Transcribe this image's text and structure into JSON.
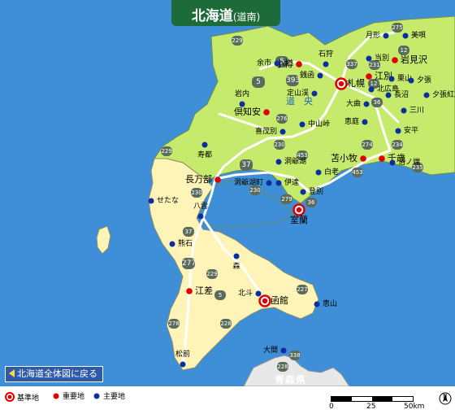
{
  "header": {
    "title": "北海道",
    "subtitle": "(道南)"
  },
  "area_label": "道　央",
  "prefecture_label": "青森県",
  "back_link": "北海道全体図に戻る",
  "legend": [
    {
      "label": "基準地",
      "color": "#e00000"
    },
    {
      "label": "重要地",
      "color": "#e00000"
    },
    {
      "label": "主要地",
      "color": "#0a2fa0"
    }
  ],
  "scale": {
    "ticks": [
      "0",
      "25",
      "50km"
    ]
  },
  "north": "N",
  "places": [
    {
      "name": "札幌",
      "kind": "基準地"
    },
    {
      "name": "室蘭",
      "kind": "基準地"
    },
    {
      "name": "函館",
      "kind": "基準地"
    },
    {
      "name": "小樽",
      "kind": "重要地"
    },
    {
      "name": "江別",
      "kind": "重要地"
    },
    {
      "name": "岩見沢",
      "kind": "重要地"
    },
    {
      "name": "千歳",
      "kind": "重要地"
    },
    {
      "name": "苫小牧",
      "kind": "重要地"
    },
    {
      "name": "倶知安",
      "kind": "重要地"
    },
    {
      "name": "長万部",
      "kind": "重要地"
    },
    {
      "name": "江差",
      "kind": "重要地"
    },
    {
      "name": "月形",
      "kind": "主要地"
    },
    {
      "name": "美唄",
      "kind": "主要地"
    },
    {
      "name": "石狩",
      "kind": "主要地"
    },
    {
      "name": "当別",
      "kind": "主要地"
    },
    {
      "name": "余市",
      "kind": "主要地"
    },
    {
      "name": "銭函",
      "kind": "主要地"
    },
    {
      "name": "栗山",
      "kind": "主要地"
    },
    {
      "name": "夕張",
      "kind": "主要地"
    },
    {
      "name": "北広島",
      "kind": "主要地"
    },
    {
      "name": "長沼",
      "kind": "主要地"
    },
    {
      "name": "夕張紅葉山",
      "kind": "主要地"
    },
    {
      "name": "大曲",
      "kind": "主要地"
    },
    {
      "name": "三川",
      "kind": "主要地"
    },
    {
      "name": "岩内",
      "kind": "主要地"
    },
    {
      "name": "定山渓",
      "kind": "主要地"
    },
    {
      "name": "中山峠",
      "kind": "主要地"
    },
    {
      "name": "喜茂別",
      "kind": "主要地"
    },
    {
      "name": "恵庭",
      "kind": "主要地"
    },
    {
      "name": "安平",
      "kind": "主要地"
    },
    {
      "name": "寿都",
      "kind": "主要地"
    },
    {
      "name": "沼ノ端",
      "kind": "主要地"
    },
    {
      "name": "洞爺湖",
      "kind": "主要地"
    },
    {
      "name": "洞爺湖町",
      "kind": "主要地"
    },
    {
      "name": "伊達",
      "kind": "主要地"
    },
    {
      "name": "白老",
      "kind": "主要地"
    },
    {
      "name": "登別",
      "kind": "主要地"
    },
    {
      "name": "せたな",
      "kind": "主要地"
    },
    {
      "name": "八雲",
      "kind": "主要地"
    },
    {
      "name": "熊石",
      "kind": "主要地"
    },
    {
      "name": "森",
      "kind": "主要地"
    },
    {
      "name": "北斗",
      "kind": "主要地"
    },
    {
      "name": "恵山",
      "kind": "主要地"
    },
    {
      "name": "松前",
      "kind": "主要地"
    },
    {
      "name": "大間",
      "kind": "主要地"
    }
  ],
  "routes": [
    "275",
    "12",
    "231",
    "337",
    "5",
    "393",
    "5",
    "12",
    "276",
    "230",
    "453",
    "36",
    "229",
    "274",
    "234",
    "37",
    "453",
    "36",
    "235",
    "229",
    "230",
    "37",
    "230",
    "277",
    "37",
    "229",
    "5",
    "227",
    "278",
    "228",
    "228",
    "338",
    "279"
  ]
}
